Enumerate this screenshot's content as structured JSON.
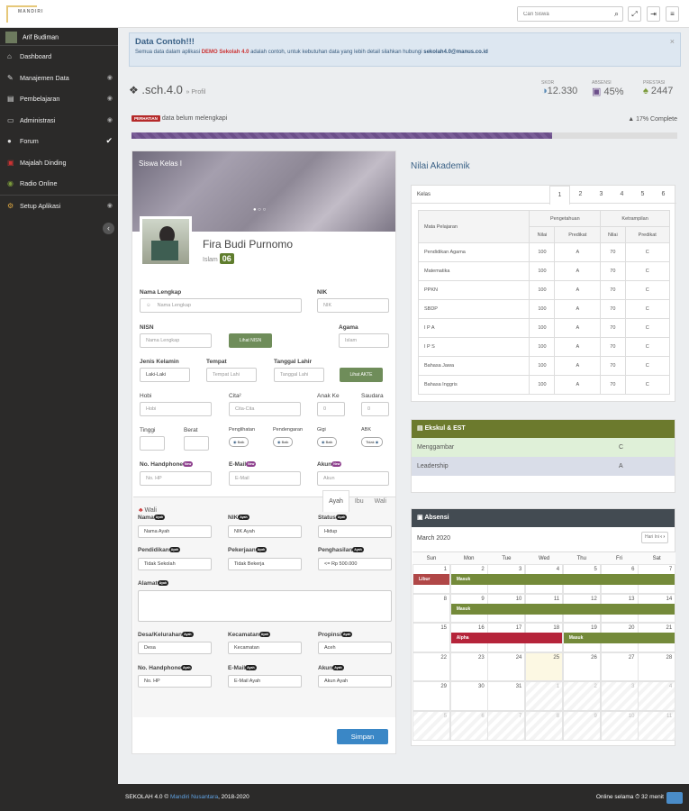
{
  "app": {
    "logo": "MANDIRI",
    "search_placeholder": "Cari Siswa"
  },
  "sidebar": {
    "user": "Arif Budiman",
    "items": [
      {
        "label": "Dashboard",
        "icon": "home-icon"
      },
      {
        "label": "Manajemen Data",
        "icon": "edit-icon"
      },
      {
        "label": "Pembelajaran",
        "icon": "book-icon"
      },
      {
        "label": "Administrasi",
        "icon": "inbox-icon"
      },
      {
        "label": "Forum",
        "icon": "comments-icon"
      },
      {
        "label": "Majalah Dinding",
        "icon": "monitor-icon"
      },
      {
        "label": "Radio Online",
        "icon": "radio-icon"
      },
      {
        "label": "Setup Aplikasi",
        "icon": "gear-icon"
      }
    ]
  },
  "alert": {
    "title": "Data Contoh!!!",
    "pre": "Semua data dalam aplikasi ",
    "highlight": "DEMO Sekolah 4.0",
    "mid": " adalah contoh, untuk kebutuhan data yang lebih detail silahkan hubungi ",
    "email": "sekolah4.0@manus.co.id"
  },
  "brand": {
    "title": ".sch.4.0",
    "sub": "» Profil"
  },
  "stats": [
    {
      "label": "SKOR",
      "value": "12.330"
    },
    {
      "label": "ABSENSI",
      "value": "45%"
    },
    {
      "label": "PRESTASI",
      "value": "2447"
    }
  ],
  "progress": {
    "badge": "PERHATIAN",
    "text": "data belum melengkapi",
    "complete": "17% Complete",
    "value": 0.77
  },
  "profile": {
    "cover_title": "Siswa Kelas I",
    "name": "Fira Budi Purnomo",
    "kelas_label": "Islam",
    "kelas_no": "06"
  },
  "form": {
    "nama_label": "Nama Lengkap",
    "nama_ph": "Nama Lengkap",
    "nik_label": "NIK",
    "nik_ph": "NIK",
    "nisn_label": "NISN",
    "nisn_ph": "Nama Lengkap",
    "lihat_nisn": "Lihat NISN",
    "agama_label": "Agama",
    "agama_ph": "Islam",
    "jk_label": "Jenis Kelamin",
    "jk_val": "Laki-Laki",
    "tempat_label": "Tempat",
    "tempat_ph": "Tempat Lahi",
    "tgl_label": "Tanggal Lahir",
    "tgl_ph": "Tanggal Lahi",
    "lihat_akte": "Lihat AKTE",
    "hobi_label": "Hobi",
    "hobi_ph": "Hobi",
    "cita_label": "Cita²",
    "cita_ph": "Cita-Cita",
    "anak_label": "Anak Ke",
    "anak_val": "0",
    "saudara_label": "Saudara",
    "saudara_val": "0",
    "tinggi_label": "Tinggi",
    "berat_label": "Berat",
    "penglihatan_label": "Penglihatan",
    "penglihatan_val": "Baik",
    "pendengaran_label": "Pendengaran",
    "pendengaran_val": "Baik",
    "gigi_label": "Gigi",
    "gigi_val": "Baik",
    "abk_label": "ABK",
    "abk_val": "Tidak",
    "hp_label": "No. Handphone",
    "hp_ph": "No. HP",
    "email_label": "E-Mail",
    "email_ph": "E-Mail",
    "akun_label": "Akun",
    "akun_ph": "Akun",
    "badge_new": "New"
  },
  "parent": {
    "title": "Wali",
    "tabs": [
      "Ayah",
      "Ibu",
      "Wali"
    ],
    "badge": "Ayah",
    "nama_label": "Nama",
    "nama_ph": "Nama Ayah",
    "nik_label": "NIK",
    "nik_ph": "NIK Ayah",
    "status_label": "Status",
    "status_val": "Hidup",
    "pend_label": "Pendidikan",
    "pend_val": "Tidak Sekolah",
    "pek_label": "Pekerjaan",
    "pek_val": "Tidak Bekerja",
    "gaji_label": "Penghasilan",
    "gaji_val": "<= Rp 500.000",
    "alamat_label": "Alamat",
    "desa_label": "Desa/Kelurahan",
    "desa_ph": "Desa",
    "kec_label": "Kecamatan",
    "kec_ph": "Kecamatan",
    "prov_label": "Propinsi",
    "prov_val": "Aceh",
    "hp_label": "No. Handphone",
    "hp_ph": "No. HP",
    "email_label": "E-Mail",
    "email_ph": "E-Mail Ayah",
    "akun_label": "Akun",
    "akun_ph": "Akun Ayah"
  },
  "save": "Simpan",
  "nilai": {
    "title": "Nilai Akademik",
    "kelas": "Kelas",
    "tabs": [
      "1",
      "2",
      "3",
      "4",
      "5",
      "6"
    ],
    "h_mapel": "Mata Pelajaran",
    "h_peng": "Pengetahuan",
    "h_ket": "Ketrampilan",
    "h_nilai": "Nilai",
    "h_pred": "Predikat",
    "rows": [
      [
        "Pendidikan Agama",
        "100",
        "A",
        "70",
        "C"
      ],
      [
        "Matematika",
        "100",
        "A",
        "70",
        "C"
      ],
      [
        "PPKN",
        "100",
        "A",
        "70",
        "C"
      ],
      [
        "SBDP",
        "100",
        "A",
        "70",
        "C"
      ],
      [
        "I P A",
        "100",
        "A",
        "70",
        "C"
      ],
      [
        "I P S",
        "100",
        "A",
        "70",
        "C"
      ],
      [
        "Bahasa Jawa",
        "100",
        "A",
        "70",
        "C"
      ],
      [
        "Bahasa Inggris",
        "100",
        "A",
        "70",
        "C"
      ]
    ]
  },
  "ekskul": {
    "title": "Ekskul & EST",
    "rows": [
      [
        "Menggambar",
        "C"
      ],
      [
        "Leadership",
        "A"
      ]
    ]
  },
  "absensi": {
    "title": "Absensi",
    "month": "March 2020",
    "nav": "Hari Ini",
    "days": [
      "Sun",
      "Mon",
      "Tue",
      "Wed",
      "Thu",
      "Fri",
      "Sat"
    ],
    "weeks": [
      [
        "1",
        "2",
        "3",
        "4",
        "5",
        "6",
        "7"
      ],
      [
        "8",
        "9",
        "10",
        "11",
        "12",
        "13",
        "14"
      ],
      [
        "15",
        "16",
        "17",
        "18",
        "19",
        "20",
        "21"
      ],
      [
        "22",
        "23",
        "24",
        "25",
        "26",
        "27",
        "28"
      ],
      [
        "29",
        "30",
        "31",
        "1",
        "2",
        "3",
        "4"
      ],
      [
        "5",
        "6",
        "7",
        "8",
        "9",
        "10",
        "11"
      ]
    ],
    "events": {
      "libur": "Libur",
      "masuk": "Masuk",
      "alpha": "Alpha"
    }
  },
  "footer": {
    "left": "SEKOLAH 4.0 © ",
    "link": "Mandiri Nusantara",
    "year": ", 2018-2020",
    "right": "Online selama ⏱ 32 menit"
  }
}
